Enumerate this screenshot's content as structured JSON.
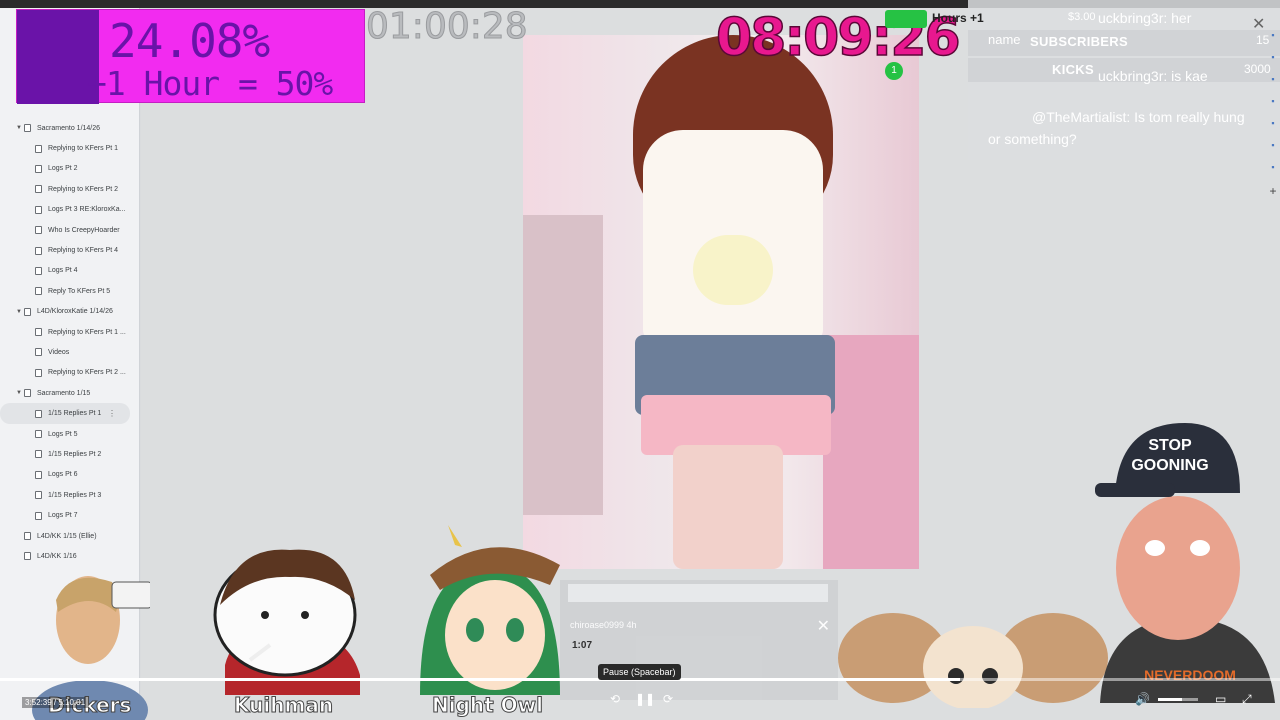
{
  "stream_overlay": {
    "goal_percent": "24.08%",
    "goal_rule": "+1 Hour = 50%",
    "uptime": "01:00:28",
    "countdown": "08:09:26",
    "hours_label": "Hours +1",
    "tip_amount": "$3.00",
    "subscribers_label": "SUBSCRIBERS",
    "subscribers_count": "15",
    "kicks_label": "KICKS",
    "kicks_count": "3000",
    "chat_fragment_1": "uckbring3r: her",
    "chat_fragment_2": "name",
    "chat_fragment_3": "uckbring3r: is kae",
    "chat_user": "@TheMartialist:",
    "chat_message": "Is tom really hung or something?",
    "badge_count": "1"
  },
  "outline": {
    "items": [
      {
        "label": "Sacramento 1/14/26",
        "level": 0,
        "expanded": true
      },
      {
        "label": "Replying to KFers Pt 1",
        "level": 1
      },
      {
        "label": "Logs Pt 2",
        "level": 1
      },
      {
        "label": "Replying to KFers Pt 2",
        "level": 1
      },
      {
        "label": "Logs Pt 3 RE:KloroxKa...",
        "level": 1
      },
      {
        "label": "Who Is CreepyHoarder",
        "level": 1
      },
      {
        "label": "Replying to KFers Pt 4",
        "level": 1
      },
      {
        "label": "Logs Pt 4",
        "level": 1
      },
      {
        "label": "Reply To KFers Pt 5",
        "level": 1
      },
      {
        "label": "L4D/KloroxKatie 1/14/26",
        "level": 0,
        "expanded": true
      },
      {
        "label": "Replying to KFers Pt 1 ...",
        "level": 1
      },
      {
        "label": "Videos",
        "level": 1
      },
      {
        "label": "Replying to KFers Pt 2 ...",
        "level": 1
      },
      {
        "label": "Sacramento 1/15",
        "level": 0,
        "expanded": true
      },
      {
        "label": "1/15 Replies Pt 1",
        "level": 1,
        "selected": true
      },
      {
        "label": "Logs Pt 5",
        "level": 1
      },
      {
        "label": "1/15 Replies Pt 2",
        "level": 1
      },
      {
        "label": "Logs Pt 6",
        "level": 1
      },
      {
        "label": "1/15 Replies Pt 3",
        "level": 1
      },
      {
        "label": "Logs Pt 7",
        "level": 1
      },
      {
        "label": "L4D/KK 1/15 (Ellie)",
        "level": 0
      },
      {
        "label": "L4D/KK 1/16",
        "level": 0
      }
    ]
  },
  "phone_overlay": {
    "username": "chiroase0999 4h",
    "time": "1:07"
  },
  "characters": {
    "left": "Dickers",
    "second": "Kuihman",
    "third": "Night Owl",
    "hat_text_line1": "STOP",
    "hat_text_line2": "GOONING",
    "shirt_text": "NEVERDOOM"
  },
  "player": {
    "time": "3:52:39 / 5:10:01",
    "tooltip": "Pause (Spacebar)",
    "progress": 0.75,
    "volume": 0.6
  },
  "colors": {
    "goal_bg": "#f22bf0",
    "goal_text": "#6a13a8",
    "countdown": "#e8188f",
    "hours_pill": "#26c244"
  }
}
